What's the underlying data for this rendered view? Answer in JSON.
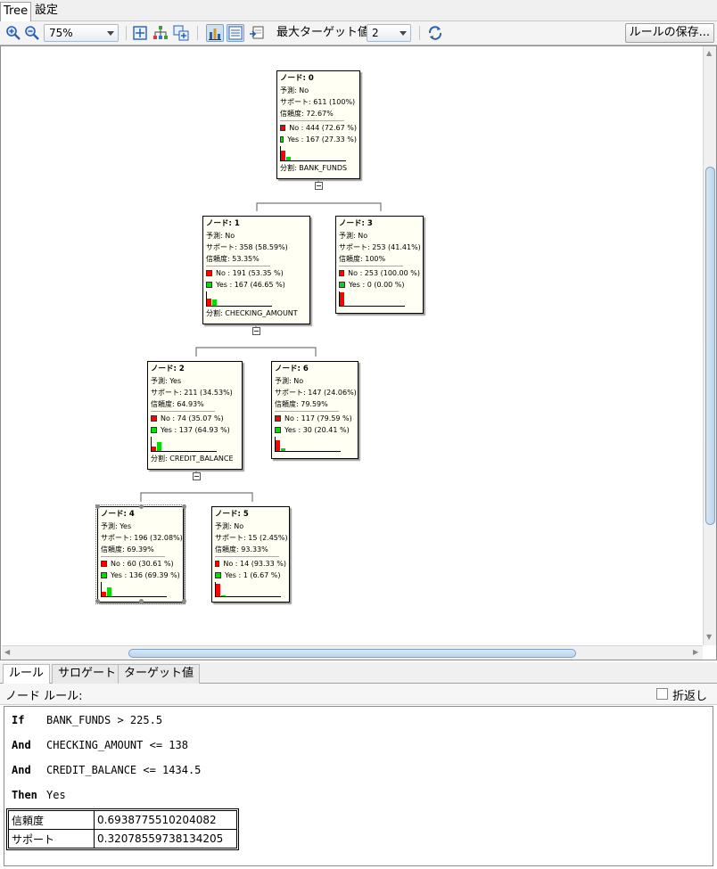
{
  "tabs": [
    "Tree",
    "設定"
  ],
  "toolbar": {
    "zoom": "75%",
    "max_target_label": "最大ターゲット値",
    "max_target_value": "2",
    "save_label": "ルールの保存..."
  },
  "tree": {
    "nodes": {
      "n0": {
        "title": "ノード: 0",
        "pred": "予測: No",
        "support": "サポート: 611 (100%)",
        "conf": "信頼度: 72.67%",
        "c1": "No : 444  (72.67 %)",
        "c2": "Yes : 167  (27.33 %)",
        "split": "分割: BANK_FUNDS",
        "no_frac": 0.7267,
        "yes_frac": 0.2733
      },
      "n1": {
        "title": "ノード: 1",
        "pred": "予測: No",
        "support": "サポート: 358 (58.59%)",
        "conf": "信頼度: 53.35%",
        "c1": "No : 191  (53.35 %)",
        "c2": "Yes : 167  (46.65 %)",
        "split": "分割: CHECKING_AMOUNT",
        "no_frac": 0.5335,
        "yes_frac": 0.4665
      },
      "n3": {
        "title": "ノード: 3",
        "pred": "予測: No",
        "support": "サポート: 253 (41.41%)",
        "conf": "信頼度: 100%",
        "c1": "No : 253  (100.00 %)",
        "c2": "Yes : 0  (0.00 %)",
        "no_frac": 1.0,
        "yes_frac": 0.0
      },
      "n2": {
        "title": "ノード: 2",
        "pred": "予測: Yes",
        "support": "サポート: 211 (34.53%)",
        "conf": "信頼度: 64.93%",
        "c1": "No : 74  (35.07 %)",
        "c2": "Yes : 137  (64.93 %)",
        "split": "分割: CREDIT_BALANCE",
        "no_frac": 0.3507,
        "yes_frac": 0.6493
      },
      "n6": {
        "title": "ノード: 6",
        "pred": "予測: No",
        "support": "サポート: 147 (24.06%)",
        "conf": "信頼度: 79.59%",
        "c1": "No : 117  (79.59 %)",
        "c2": "Yes : 30  (20.41 %)",
        "no_frac": 0.7959,
        "yes_frac": 0.2041
      },
      "n4": {
        "title": "ノード: 4",
        "pred": "予測: Yes",
        "support": "サポート: 196 (32.08%)",
        "conf": "信頼度: 69.39%",
        "c1": "No : 60  (30.61 %)",
        "c2": "Yes : 136  (69.39 %)",
        "no_frac": 0.3061,
        "yes_frac": 0.6939
      },
      "n5": {
        "title": "ノード: 5",
        "pred": "予測: No",
        "support": "サポート: 15 (2.45%)",
        "conf": "信頼度: 93.33%",
        "c1": "No : 14  (93.33 %)",
        "c2": "Yes : 1  (6.67 %)",
        "no_frac": 0.9333,
        "yes_frac": 0.0667
      }
    },
    "colors": {
      "no": "#ff0000",
      "yes": "#00dd00"
    }
  },
  "bottom_tabs": [
    "ルール",
    "サロゲート",
    "ターゲット値"
  ],
  "rule_panel": {
    "header": "ノード ルール:",
    "wrap_label": "折返し",
    "lines": [
      {
        "kw": "If",
        "text": "BANK_FUNDS > 225.5"
      },
      {
        "kw": "And",
        "text": "CHECKING_AMOUNT <= 138"
      },
      {
        "kw": "And",
        "text": "CREDIT_BALANCE <= 1434.5"
      },
      {
        "kw": "Then",
        "text": "Yes"
      }
    ],
    "metrics": [
      {
        "k": "信頼度",
        "v": "0.6938775510204082"
      },
      {
        "k": "サポート",
        "v": "0.32078559738134205"
      }
    ]
  }
}
